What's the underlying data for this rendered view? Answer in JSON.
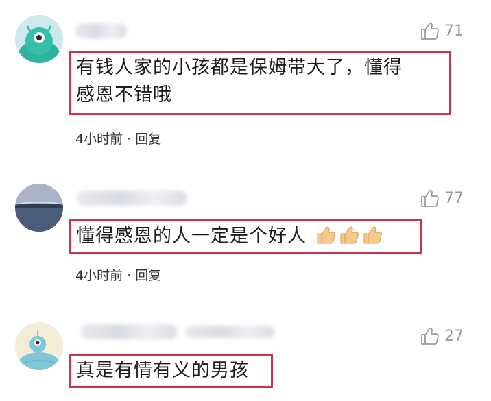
{
  "comments": [
    {
      "likes": "71",
      "text_line1": "有钱人家的小孩都是保姆带大了，懂得",
      "text_line2": "感恩不错哦",
      "time": "4小时前",
      "separator": "·",
      "reply": "回复"
    },
    {
      "likes": "77",
      "text": "懂得感恩的人一定是个好人",
      "time": "4小时前",
      "separator": "·",
      "reply": "回复"
    },
    {
      "likes": "27",
      "text": "真是有情有义的男孩"
    }
  ],
  "colors": {
    "highlight_border": "#c9354a",
    "like_gray": "#9a9a9a"
  },
  "icons": [
    "avatar-monster",
    "avatar-landscape",
    "avatar-alien",
    "thumbs-up-outline-icon",
    "thumbs-up-emoji-icon"
  ]
}
